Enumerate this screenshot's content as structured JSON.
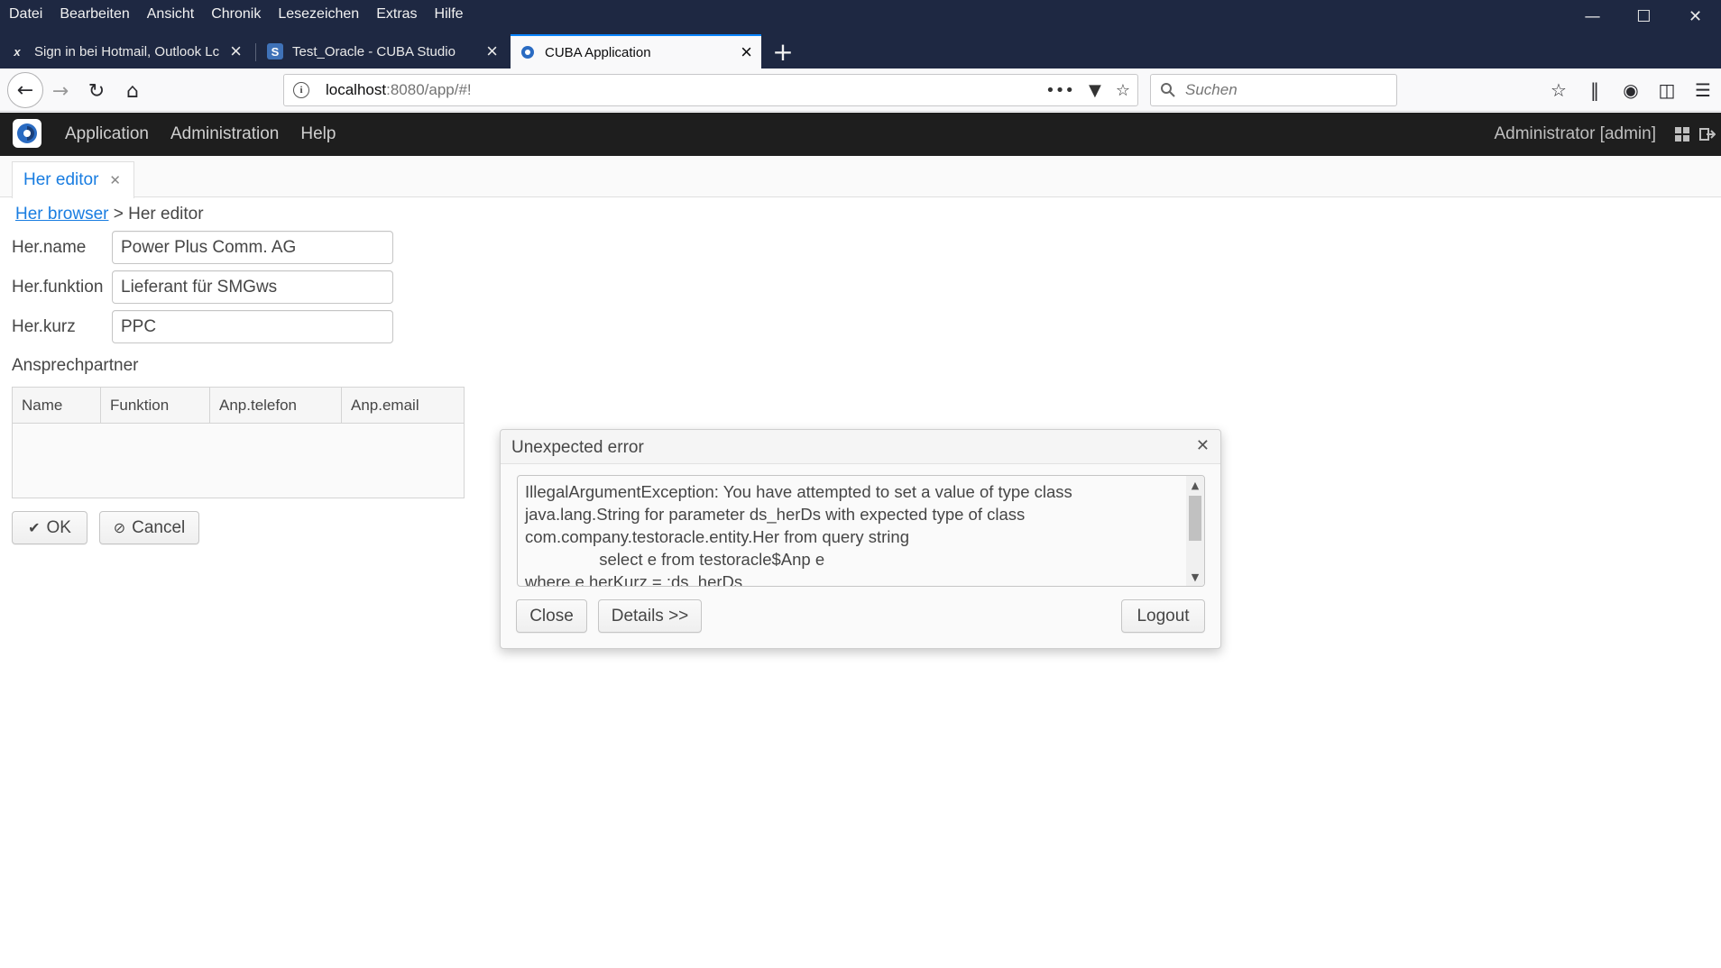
{
  "browser": {
    "menu": [
      "Datei",
      "Bearbeiten",
      "Ansicht",
      "Chronik",
      "Lesezeichen",
      "Extras",
      "Hilfe"
    ],
    "tabs": [
      {
        "title": "Sign in bei Hotmail, Outlook Lc",
        "favicon": "outlook-icon"
      },
      {
        "title": "Test_Oracle - CUBA Studio",
        "favicon": "S"
      },
      {
        "title": "CUBA Application",
        "favicon": "cuba-icon"
      }
    ],
    "url_host": "localhost",
    "url_rest": ":8080/app/#!",
    "search_placeholder": "Suchen"
  },
  "app": {
    "menu": [
      "Application",
      "Administration",
      "Help"
    ],
    "user": "Administrator [admin]",
    "workspace_tab": "Her editor",
    "breadcrumb": {
      "link": "Her browser",
      "current": "> Her editor"
    },
    "fields": [
      {
        "label": "Her.name",
        "value": "Power Plus Comm. AG"
      },
      {
        "label": "Her.funktion",
        "value": "Lieferant für SMGws"
      },
      {
        "label": "Her.kurz",
        "value": "PPC"
      }
    ],
    "section_caption": "Ansprechpartner",
    "grid_columns": [
      "Name",
      "Funktion",
      "Anp.telefon",
      "Anp.email"
    ],
    "ok_label": "OK",
    "cancel_label": "Cancel"
  },
  "dialog": {
    "title": "Unexpected error",
    "message": "IllegalArgumentException: You have attempted to set a value of type class java.lang.String for parameter ds_herDs with expected type of class com.company.testoracle.entity.Her from query string\n\t\tselect e from testoracle$Anp e\nwhere e.herKurz = :ds_herDs",
    "close_label": "Close",
    "details_label": "Details >>",
    "logout_label": "Logout"
  }
}
